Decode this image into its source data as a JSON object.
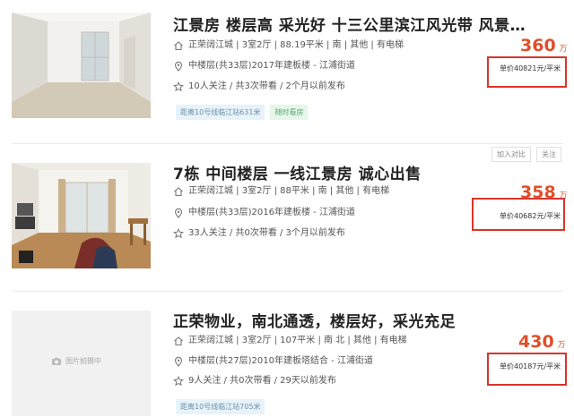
{
  "listings": [
    {
      "title": "江景房 楼层高 采光好 十三公里滨江风光带 风景…",
      "info": "正荣阔江城 | 3室2厅 | 88.19平米 | 南 | 其他 | 有电梯",
      "floor": "中楼层(共33层)2017年建板楼 - 江浦街道",
      "follow": "10人关注 / 共3次带看 / 2个月以前发布",
      "tags": [
        "距离10号线临江站631米",
        "随时看房"
      ],
      "price": "360",
      "price_unit": "万",
      "unit_price": "单价40821元/平米"
    },
    {
      "title": "7栋 中间楼层 一线江景房 诚心出售",
      "info": "正荣阔江城 | 3室2厅 | 88平米 | 南 | 其他 | 有电梯",
      "floor": "中楼层(共33层)2016年建板楼 - 江浦街道",
      "follow": "33人关注 / 共0次带看 / 3个月以前发布",
      "tags": [],
      "price": "358",
      "price_unit": "万",
      "unit_price": "单价40682元/平米",
      "actions": [
        "加入对比",
        "关注"
      ]
    },
    {
      "title": "正荣物业，南北通透，楼层好，采光充足",
      "info": "正荣阔江城 | 3室2厅 | 107平米 | 南 北 | 其他 | 有电梯",
      "floor": "中楼层(共27层)2010年建板塔结合 - 江浦街道",
      "follow": "9人关注 / 共0次带看 / 29天以前发布",
      "tags": [
        "距离10号线临江站705米"
      ],
      "price": "430",
      "price_unit": "万",
      "unit_price": "单价40187元/平米",
      "photo_placeholder": "图片拍摄中"
    }
  ],
  "colors": {
    "price": "#e04f2a",
    "highlight_box": "#d9342b",
    "tag_blue_bg": "#e7f3fb",
    "tag_green_bg": "#e6f6ea"
  },
  "icons": [
    "house-icon",
    "location-icon",
    "star-icon",
    "camera-icon"
  ]
}
